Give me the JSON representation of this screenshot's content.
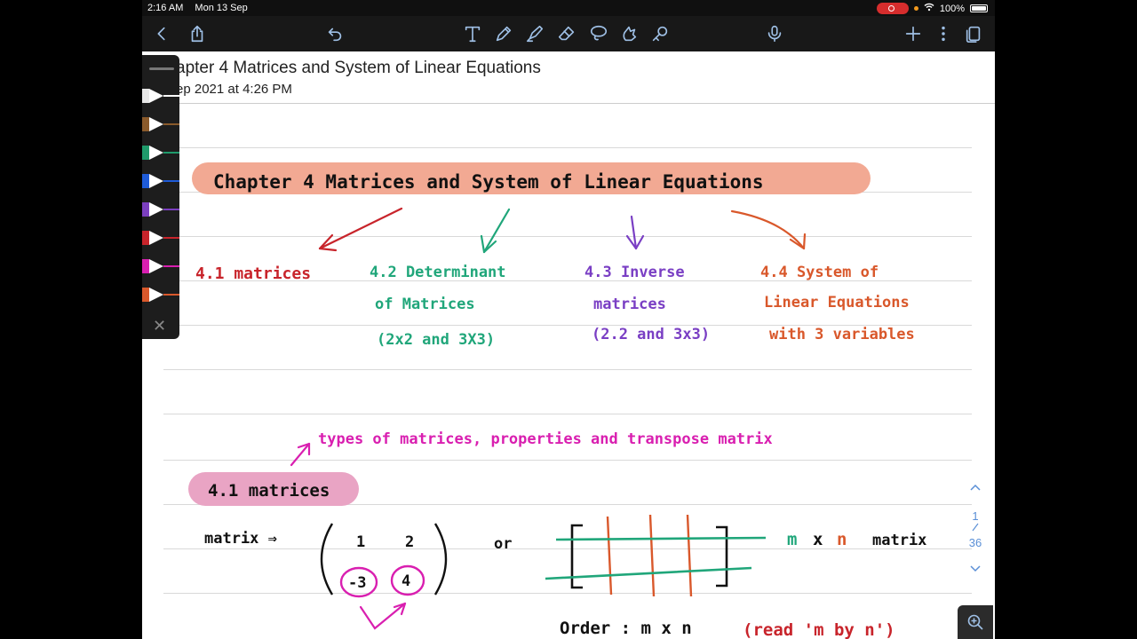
{
  "status_bar": {
    "time": "2:16 AM",
    "date": "Mon 13 Sep",
    "battery": "100%"
  },
  "toolbar": {
    "icons": [
      "chevron-left-icon",
      "share-icon",
      "undo-icon",
      "text-tool-icon",
      "pen-tool-icon",
      "highlighter-tool-icon",
      "eraser-tool-icon",
      "lasso-tool-icon",
      "shapes-tool-icon",
      "laser-pointer-icon",
      "microphone-icon",
      "add-icon",
      "more-icon",
      "pages-icon"
    ]
  },
  "document": {
    "title": "apter 4 Matrices and System of Linear Equations",
    "subtitle": "ep 2021 at 4:26 PM"
  },
  "palette": {
    "pens": [
      {
        "band": "#e8e8e8",
        "nib": "#ffffff"
      },
      {
        "band": "#8a5a2b",
        "nib": "#8a5a2b"
      },
      {
        "band": "#1f9a6b",
        "nib": "#1f9a6b"
      },
      {
        "band": "#1e5bd8",
        "nib": "#1e5bd8"
      },
      {
        "band": "#7b3fbf",
        "nib": "#7b3fbf"
      },
      {
        "band": "#c8242b",
        "nib": "#c8242b"
      },
      {
        "band": "#d91fb0",
        "nib": "#d91fb0"
      },
      {
        "band": "#d9582b",
        "nib": "#d9582b"
      }
    ]
  },
  "notes": {
    "chapter_banner": "Chapter 4 Matrices and System of Linear Equations",
    "topic_1": "4.1 matrices",
    "topic_2_line1": "4.2 Determinant",
    "topic_2_line2": "of Matrices",
    "topic_2_line3": "(2x2 and 3X3)",
    "topic_3_line1": "4.3 Inverse",
    "topic_3_line2": "matrices",
    "topic_3_line3": "(2.2 and 3x3)",
    "topic_4_line1": "4.4 System of",
    "topic_4_line2": "Linear Equations",
    "topic_4_line3": "with 3 variables",
    "types_note": "types of matrices, properties and transpose matrix",
    "section_banner": "4.1 matrices",
    "matrix_label": "matrix ⇒",
    "m11": "1",
    "m12": "2",
    "m21": "-3",
    "m22": "4",
    "or_label": "or",
    "mxn_m": "m",
    "mxn_x": "x",
    "mxn_n": "n",
    "matrix_word": "matrix",
    "order_label": "Order :  m x n",
    "order_read": "(read 'm by n')",
    "colors": {
      "banner": "#f2a993",
      "section_banner": "#e9a4c4",
      "red": "#c8242b",
      "green": "#20a67a",
      "purple": "#7a3fc4",
      "orange": "#d9582b",
      "magenta": "#d91fb0"
    }
  },
  "page_nav": {
    "current": "1",
    "total": "36"
  }
}
